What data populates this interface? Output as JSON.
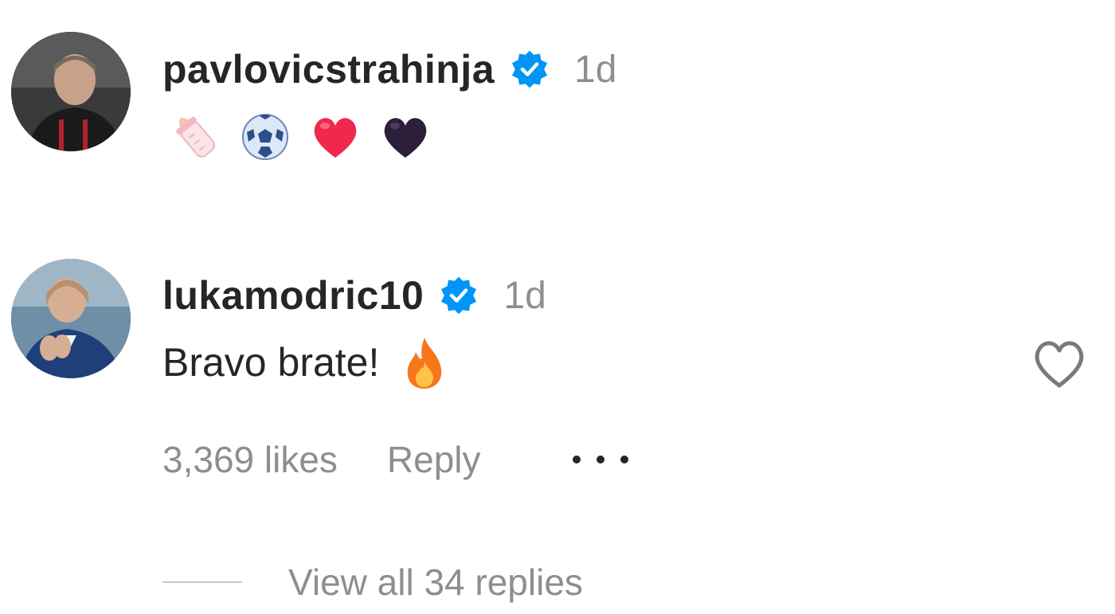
{
  "comments": [
    {
      "username": "pavlovicstrahinja",
      "time": "1d",
      "emoji": [
        "baby-bottle-emoji",
        "soccer-ball-emoji",
        "red-heart-emoji",
        "black-heart-emoji"
      ]
    },
    {
      "username": "lukamodric10",
      "time": "1d",
      "text": "Bravo brate!",
      "emoji": [
        "fire-emoji"
      ],
      "likes": "3,369 likes",
      "reply_label": "Reply",
      "view_replies": "View all 34 replies"
    }
  ],
  "colors": {
    "verified": "#0095f6",
    "secondary_text": "#8e8e8e",
    "primary_text": "#262626"
  }
}
